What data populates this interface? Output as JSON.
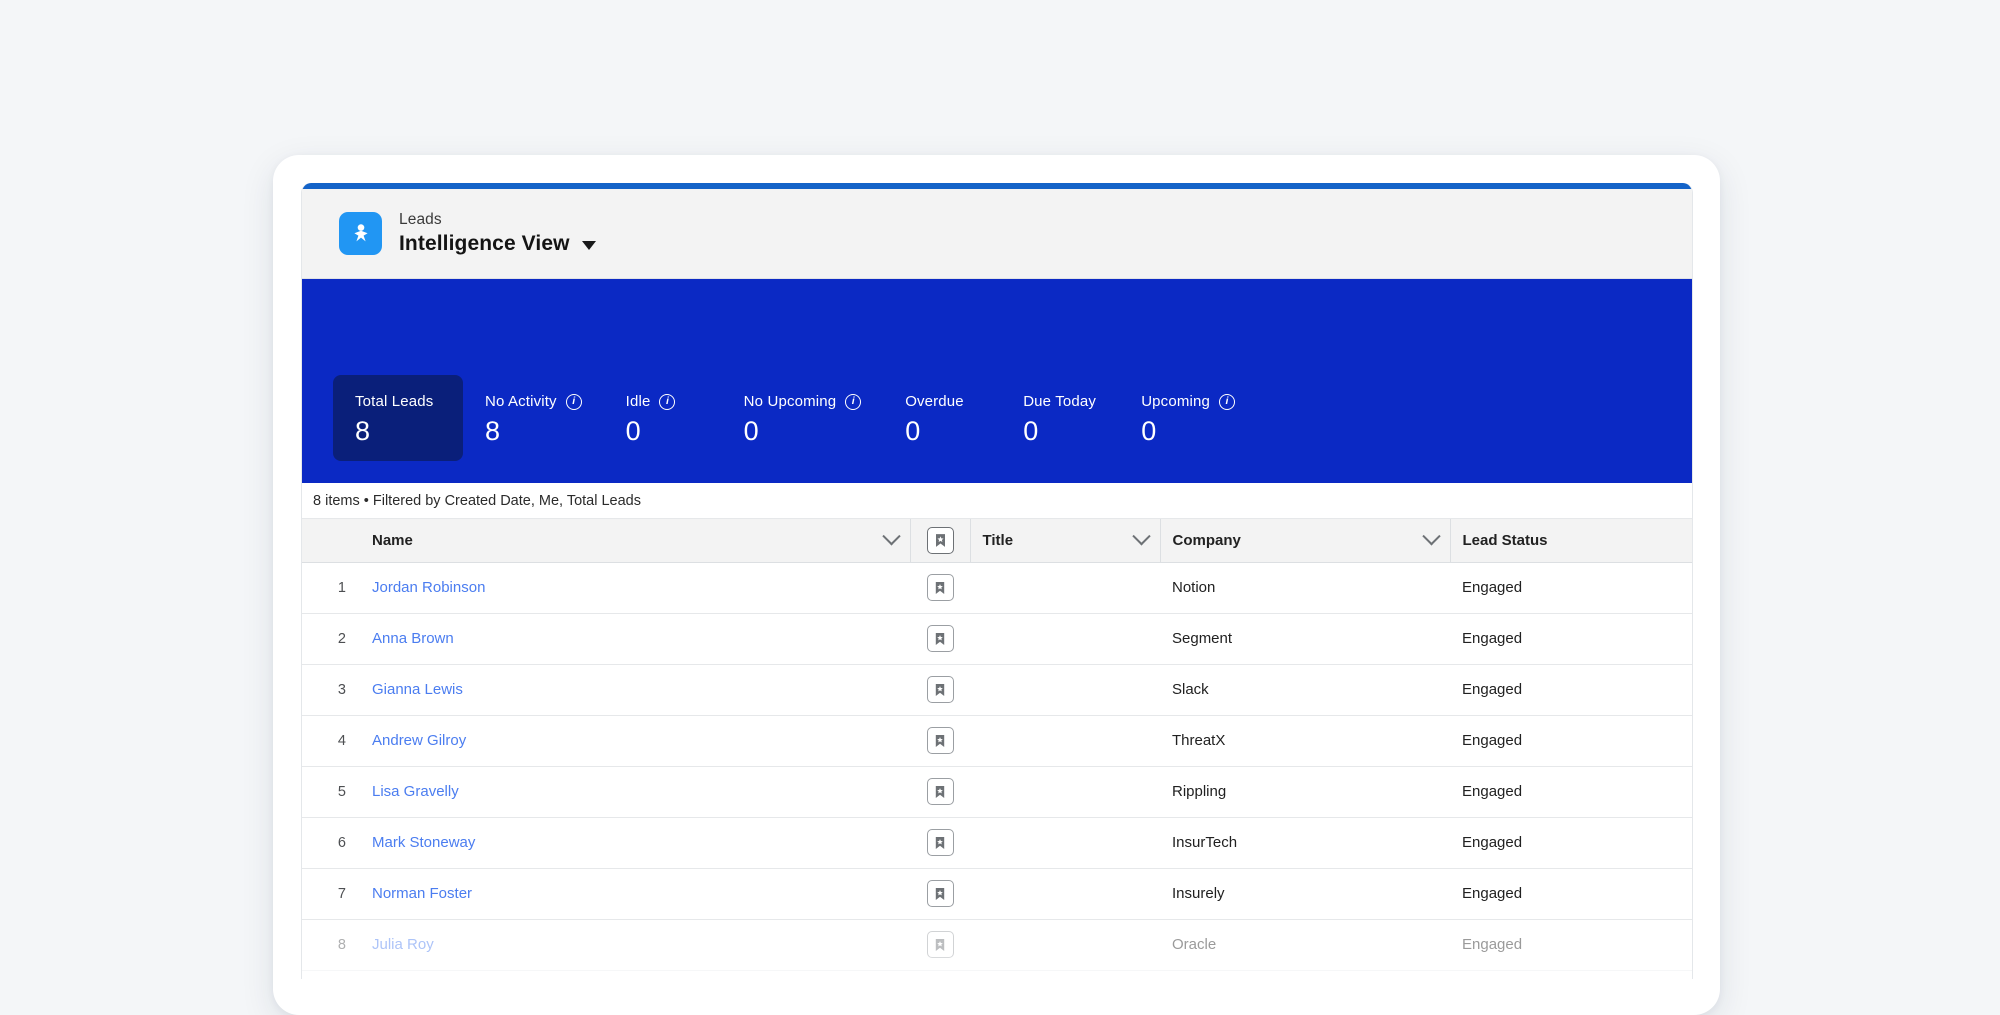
{
  "header": {
    "app_icon": "leads-person-icon",
    "eyebrow": "Leads",
    "title": "Intelligence View",
    "caret": "chevron-down-icon"
  },
  "metrics": [
    {
      "label": "Total Leads",
      "value": "8",
      "has_info": false,
      "active": true
    },
    {
      "label": "No Activity",
      "value": "8",
      "has_info": true,
      "active": false
    },
    {
      "label": "Idle",
      "value": "0",
      "has_info": true,
      "active": false
    },
    {
      "label": "No Upcoming",
      "value": "0",
      "has_info": true,
      "active": false
    },
    {
      "label": "Overdue",
      "value": "0",
      "has_info": false,
      "active": false
    },
    {
      "label": "Due Today",
      "value": "0",
      "has_info": false,
      "active": false
    },
    {
      "label": "Upcoming",
      "value": "0",
      "has_info": true,
      "active": false
    }
  ],
  "list_info": "8 items • Filtered by Created Date, Me, Total Leads",
  "table": {
    "columns": [
      {
        "key": "index",
        "label": "",
        "sortable": false
      },
      {
        "key": "name",
        "label": "Name",
        "sortable": true
      },
      {
        "key": "flag",
        "label": "bookmark-icon",
        "sortable": false
      },
      {
        "key": "title",
        "label": "Title",
        "sortable": true
      },
      {
        "key": "company",
        "label": "Company",
        "sortable": true
      },
      {
        "key": "status",
        "label": "Lead Status",
        "sortable": false
      }
    ],
    "rows": [
      {
        "index": "1",
        "name": "Jordan Robinson",
        "title": "",
        "company": "Notion",
        "status": "Engaged"
      },
      {
        "index": "2",
        "name": "Anna Brown",
        "title": "",
        "company": "Segment",
        "status": "Engaged"
      },
      {
        "index": "3",
        "name": "Gianna Lewis",
        "title": "",
        "company": "Slack",
        "status": "Engaged"
      },
      {
        "index": "4",
        "name": "Andrew Gilroy",
        "title": "",
        "company": "ThreatX",
        "status": "Engaged"
      },
      {
        "index": "5",
        "name": "Lisa Gravelly",
        "title": "",
        "company": "Rippling",
        "status": "Engaged"
      },
      {
        "index": "6",
        "name": "Mark Stoneway",
        "title": "",
        "company": "InsurTech",
        "status": "Engaged"
      },
      {
        "index": "7",
        "name": "Norman Foster",
        "title": "",
        "company": "Insurely",
        "status": "Engaged"
      },
      {
        "index": "8",
        "name": "Julia Roy",
        "title": "",
        "company": "Oracle",
        "status": "Engaged"
      }
    ]
  },
  "colors": {
    "page_background": "#f4f6f8",
    "accent_bar": "#1463c8",
    "kpi_band": "#0b29c4",
    "kpi_active": "#0a1f7a",
    "app_icon": "#2196f3",
    "link": "#4b7df0",
    "header_gray": "#f3f3f3"
  }
}
